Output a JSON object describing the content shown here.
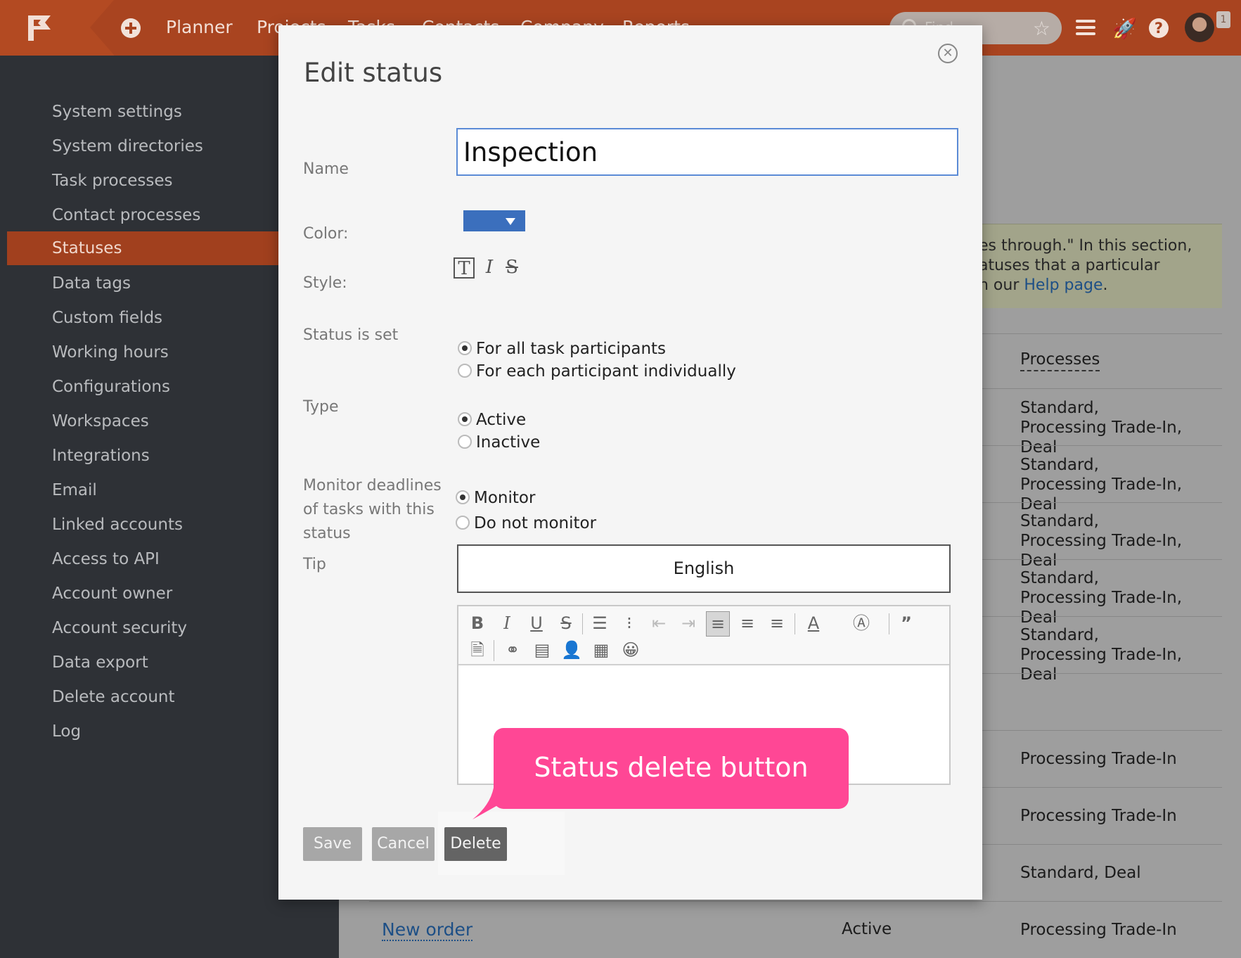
{
  "topbar": {
    "nav": [
      "Planner",
      "Projects",
      "Tasks",
      "Contacts",
      "Company",
      "Reports"
    ],
    "search_placeholder": "Find",
    "notification_count": "1"
  },
  "sidebar": {
    "items": [
      {
        "label": "System settings"
      },
      {
        "label": "System directories"
      },
      {
        "label": "Task processes"
      },
      {
        "label": "Contact processes"
      },
      {
        "label": "Statuses",
        "active": true
      },
      {
        "label": "Data tags"
      },
      {
        "label": "Custom fields"
      },
      {
        "label": "Working hours"
      },
      {
        "label": "Configurations"
      },
      {
        "label": "Workspaces"
      },
      {
        "label": "Integrations"
      },
      {
        "label": "Email"
      },
      {
        "label": "Linked accounts"
      },
      {
        "label": "Access to API"
      },
      {
        "label": "Account owner"
      },
      {
        "label": "Account security"
      },
      {
        "label": "Data export"
      },
      {
        "label": "Delete account"
      },
      {
        "label": "Log"
      }
    ]
  },
  "background": {
    "info_lines": [
      "es through.\" In this section,",
      "atuses that a particular",
      "n our "
    ],
    "info_link": "Help page",
    "info_link_suffix": ".",
    "column_header": "Processes",
    "rows": [
      {
        "processes": "Standard, Processing Trade-In, Deal"
      },
      {
        "processes": "Standard, Processing Trade-In, Deal"
      },
      {
        "processes": "Standard, Processing Trade-In, Deal"
      },
      {
        "processes": "Standard, Processing Trade-In, Deal"
      },
      {
        "processes": "Standard, Processing Trade-In, Deal"
      },
      {
        "processes": ""
      },
      {
        "processes": "Processing Trade-In"
      },
      {
        "processes": "Processing Trade-In"
      },
      {
        "processes": "Standard, Deal"
      },
      {
        "processes": "Processing Trade-In"
      }
    ],
    "last_row": {
      "name": "New order",
      "type": "Active",
      "processes": "Processing Trade-In"
    }
  },
  "modal": {
    "title": "Edit status",
    "name_label": "Name",
    "name_value": "Inspection",
    "color_label": "Color:",
    "color_value": "#3b6fbd",
    "style_label": "Style:",
    "status_set_label": "Status is set",
    "status_set_options": [
      "For all task participants",
      "For each participant individually"
    ],
    "status_set_selected": 0,
    "type_label": "Type",
    "type_options": [
      "Active",
      "Inactive"
    ],
    "type_selected": 0,
    "monitor_label_lines": [
      "Monitor deadlines",
      "of tasks with this",
      "status"
    ],
    "monitor_options": [
      "Monitor",
      "Do not monitor"
    ],
    "monitor_selected": 0,
    "tip_label": "Tip",
    "language": "English",
    "buttons": {
      "save": "Save",
      "cancel": "Cancel",
      "delete": "Delete"
    }
  },
  "callout": {
    "text": "Status delete button"
  },
  "colors": {
    "accent": "#a94420",
    "sidebar_bg": "#2e3136",
    "callout": "#ff4795"
  }
}
